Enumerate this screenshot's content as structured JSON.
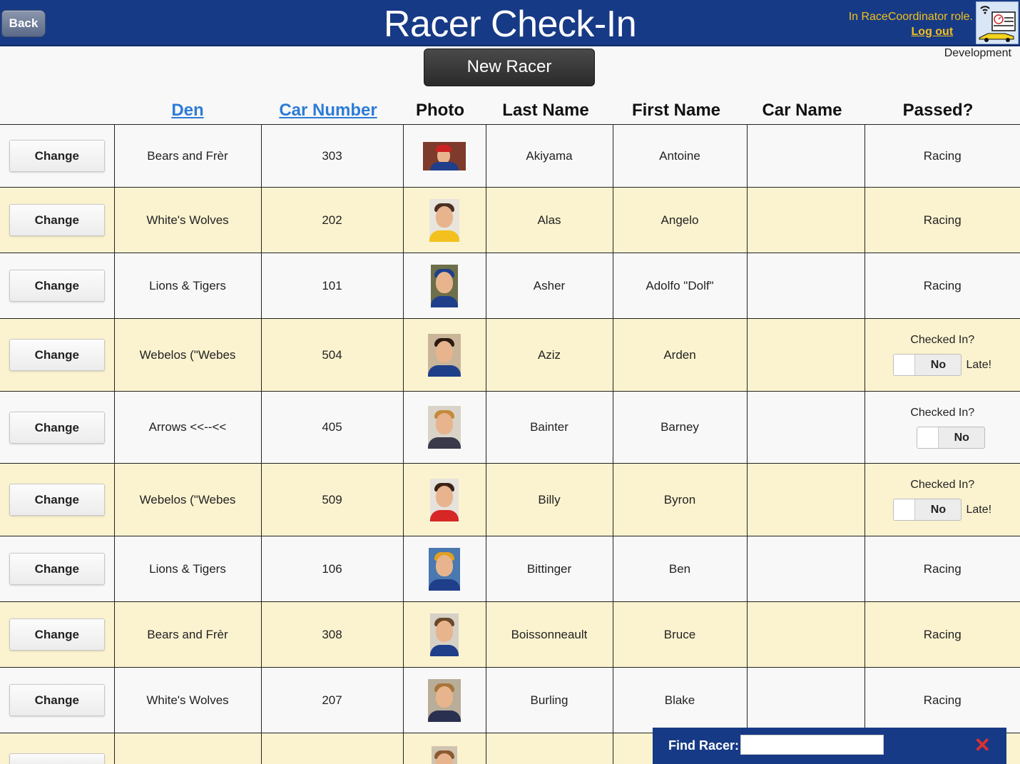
{
  "header": {
    "back_label": "Back",
    "title": "Racer Check-In",
    "role_text": "In RaceCoordinator role.",
    "logout_label": "Log out",
    "environment": "Development"
  },
  "toolbar": {
    "new_racer_label": "New Racer"
  },
  "columns": {
    "den": "Den",
    "car_number": "Car Number",
    "photo": "Photo",
    "last_name": "Last Name",
    "first_name": "First Name",
    "car_name": "Car Name",
    "passed": "Passed?"
  },
  "labels": {
    "change": "Change",
    "checked_in": "Checked In?",
    "toggle_no": "No",
    "late": "Late!",
    "racing": "Racing"
  },
  "racers": [
    {
      "den": "Bears and Frèr",
      "car_number": "303",
      "last_name": "Akiyama",
      "first_name": "Antoine",
      "car_name": "",
      "status": "Racing"
    },
    {
      "den": "White's Wolves",
      "car_number": "202",
      "last_name": "Alas",
      "first_name": "Angelo",
      "car_name": "",
      "status": "Racing"
    },
    {
      "den": "Lions & Tigers",
      "car_number": "101",
      "last_name": "Asher",
      "first_name": "Adolfo \"Dolf\"",
      "car_name": "",
      "status": "Racing"
    },
    {
      "den": "Webelos (\"Webes",
      "car_number": "504",
      "last_name": "Aziz",
      "first_name": "Arden",
      "car_name": "",
      "status": "Checked In?",
      "late": true
    },
    {
      "den": "Arrows <<--<<",
      "car_number": "405",
      "last_name": "Bainter",
      "first_name": "Barney",
      "car_name": "",
      "status": "Checked In?",
      "late": false
    },
    {
      "den": "Webelos (\"Webes",
      "car_number": "509",
      "last_name": "Billy",
      "first_name": "Byron",
      "car_name": "",
      "status": "Checked In?",
      "late": true
    },
    {
      "den": "Lions & Tigers",
      "car_number": "106",
      "last_name": "Bittinger",
      "first_name": "Ben",
      "car_name": "",
      "status": "Racing"
    },
    {
      "den": "Bears and Frèr",
      "car_number": "308",
      "last_name": "Boissonneault",
      "first_name": "Bruce",
      "car_name": "",
      "status": "Racing"
    },
    {
      "den": "White's Wolves",
      "car_number": "207",
      "last_name": "Burling",
      "first_name": "Blake",
      "car_name": "",
      "status": "Racing"
    }
  ],
  "find": {
    "label": "Find Racer:",
    "value": ""
  },
  "colors": {
    "header_bg": "#173a86",
    "accent_gold": "#f2c11d",
    "row_alt": "#fbf3cf",
    "link_blue": "#2d7cd6",
    "close_red": "#e02f2f"
  }
}
